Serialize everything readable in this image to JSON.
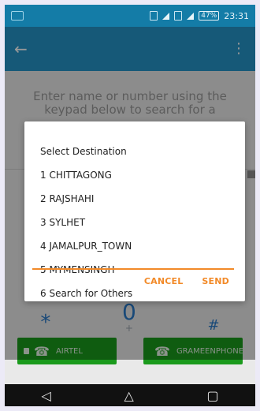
{
  "status": {
    "battery": "47%",
    "time": "23:31"
  },
  "prompt": "Enter name or number using the keypad below to search for a",
  "keypad": {
    "star": "*",
    "zero": "0",
    "plus": "+",
    "hash": "#"
  },
  "carriers": {
    "left": "AIRTEL",
    "right": "GRAMEENPHONE"
  },
  "dialog": {
    "title": "Select Destination",
    "items": [
      "1 CHITTAGONG",
      "2 RAJSHAHI",
      "3 SYLHET",
      "4 JAMALPUR_TOWN",
      "5 MYMENSINGH",
      "6 Search for Others"
    ],
    "input_value": "",
    "cancel": "CANCEL",
    "send": "SEND"
  },
  "icons": {
    "back": "arrow-left-icon",
    "more": "more-vert-icon",
    "nav_back": "triangle-back-icon",
    "nav_home": "home-circle-icon",
    "nav_recent": "recent-square-icon"
  },
  "colors": {
    "accent": "#f28a28",
    "primary": "#2595c8",
    "green": "#1a9a1c",
    "keypad": "#2b7bc9"
  }
}
